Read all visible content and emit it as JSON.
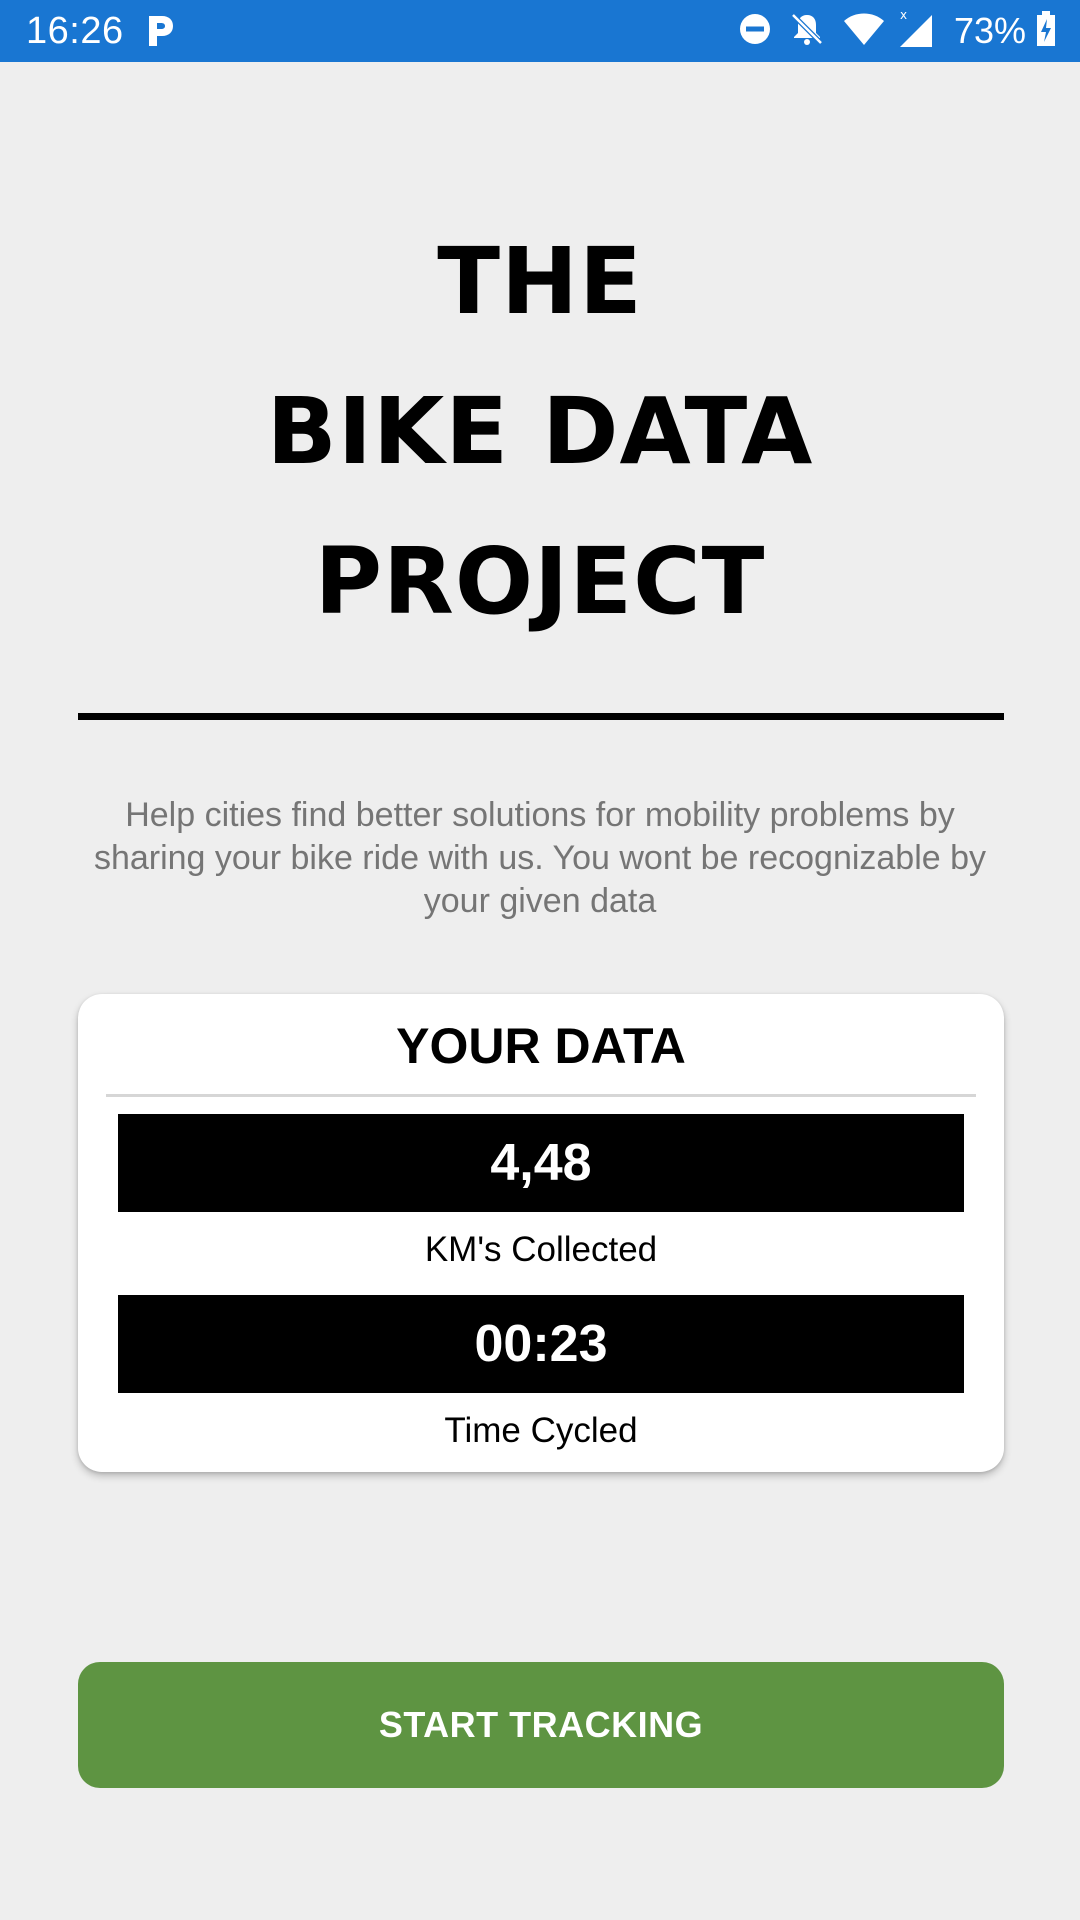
{
  "status_bar": {
    "time": "16:26",
    "battery": "73%",
    "icons": [
      "parking-app-icon",
      "do-not-disturb-icon",
      "notifications-off-icon",
      "wifi-icon",
      "signal-icon",
      "battery-charging-icon"
    ],
    "background_color": "#1976d2"
  },
  "header": {
    "title_lines": [
      "THE",
      "BIKE DATA",
      "PROJECT"
    ]
  },
  "description": "Help cities find better solutions for mobility problems by sharing your bike ride with us. You wont be recognizable by your given data",
  "data_card": {
    "title": "YOUR DATA",
    "stats": [
      {
        "value": "4,48",
        "label": "KM's Collected"
      },
      {
        "value": "00:23",
        "label": "Time Cycled"
      }
    ]
  },
  "actions": {
    "start_label": "START TRACKING",
    "start_color": "#5e9442"
  }
}
